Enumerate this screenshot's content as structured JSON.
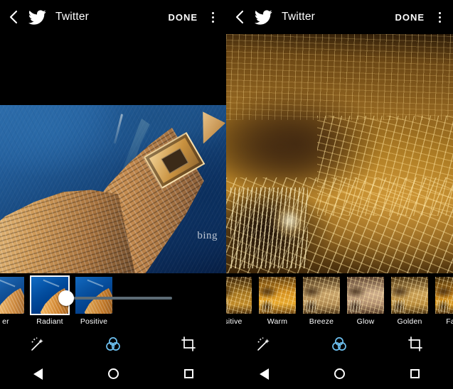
{
  "app": {
    "title": "Twitter",
    "done_label": "DONE",
    "back_icon": "back-chevron-icon",
    "logo_icon": "twitter-bird-icon",
    "overflow_icon": "overflow-menu-icon"
  },
  "left_panel": {
    "photo": {
      "name": "aerial-coastal-town-photo",
      "watermark": "bing"
    },
    "slider": {
      "name": "filter-intensity-slider",
      "value": 0,
      "min": 0,
      "max": 100
    },
    "filters": [
      {
        "label": "er",
        "selected": false,
        "truncated": true
      },
      {
        "label": "Radiant",
        "selected": true,
        "truncated": false
      },
      {
        "label": "Positive",
        "selected": false,
        "truncated": false
      }
    ],
    "toolbar": [
      {
        "label": "Enhance",
        "icon": "magic-wand-icon",
        "active": false
      },
      {
        "label": "Filters",
        "icon": "color-circles-icon",
        "active": true
      },
      {
        "label": "Crop",
        "icon": "crop-icon",
        "active": false
      }
    ]
  },
  "right_panel": {
    "photo": {
      "name": "aerial-night-cityscape-photo"
    },
    "filters": [
      {
        "label": "sitive",
        "selected": false,
        "truncated": true
      },
      {
        "label": "Warm",
        "selected": false,
        "truncated": false
      },
      {
        "label": "Breeze",
        "selected": false,
        "truncated": false
      },
      {
        "label": "Glow",
        "selected": false,
        "truncated": false
      },
      {
        "label": "Golden",
        "selected": false,
        "truncated": false
      },
      {
        "label": "Fam",
        "selected": false,
        "truncated": true
      }
    ],
    "toolbar": [
      {
        "label": "Enhance",
        "icon": "magic-wand-icon",
        "active": false
      },
      {
        "label": "Filters",
        "icon": "color-circles-icon",
        "active": true
      },
      {
        "label": "Crop",
        "icon": "crop-icon",
        "active": false
      }
    ]
  },
  "navbar": {
    "back": "back-nav-button",
    "home": "home-nav-button",
    "recents": "recents-nav-button"
  },
  "colors": {
    "accent": "#6dc0f0",
    "background": "#000000",
    "text": "#ffffff",
    "slider_track": "#5c6b75"
  }
}
